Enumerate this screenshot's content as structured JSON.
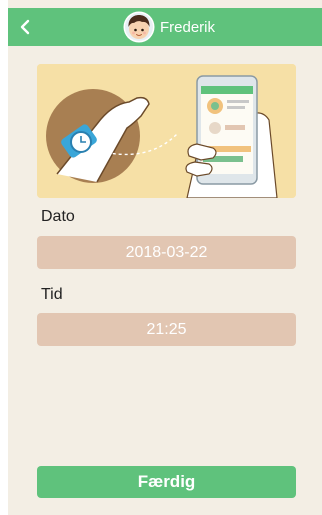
{
  "header": {
    "title": "Frederik",
    "back_icon": "chevron-left-icon",
    "avatar_icon": "child-avatar-icon"
  },
  "illustration": {
    "name": "watch-sync-illustration"
  },
  "date": {
    "label": "Dato",
    "value": "2018-03-22"
  },
  "time": {
    "label": "Tid",
    "value": "21:25"
  },
  "done_button": {
    "label": "Færdig"
  },
  "colors": {
    "accent": "#5fc27c",
    "background": "#f3eee4",
    "field": "#e2c6b2",
    "illustration_bg": "#f6e0a6"
  }
}
